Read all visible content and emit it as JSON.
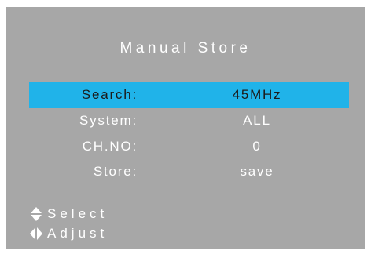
{
  "menu": {
    "title": "Manual Store",
    "rows": [
      {
        "label": "Search:",
        "value": "45MHz",
        "selected": true
      },
      {
        "label": "System:",
        "value": "ALL",
        "selected": false
      },
      {
        "label": "CH.NO:",
        "value": "0",
        "selected": false
      },
      {
        "label": "Store:",
        "value": "save",
        "selected": false
      }
    ]
  },
  "hints": {
    "select_label": "Select",
    "select_icon": "up-down-arrows-icon",
    "adjust_label": "Adjust",
    "adjust_icon": "left-right-arrows-icon"
  },
  "colors": {
    "panel_background": "#a7a7a7",
    "highlight": "#20b3e9",
    "text": "#ffffff",
    "selected_text": "#1b1b1b"
  }
}
